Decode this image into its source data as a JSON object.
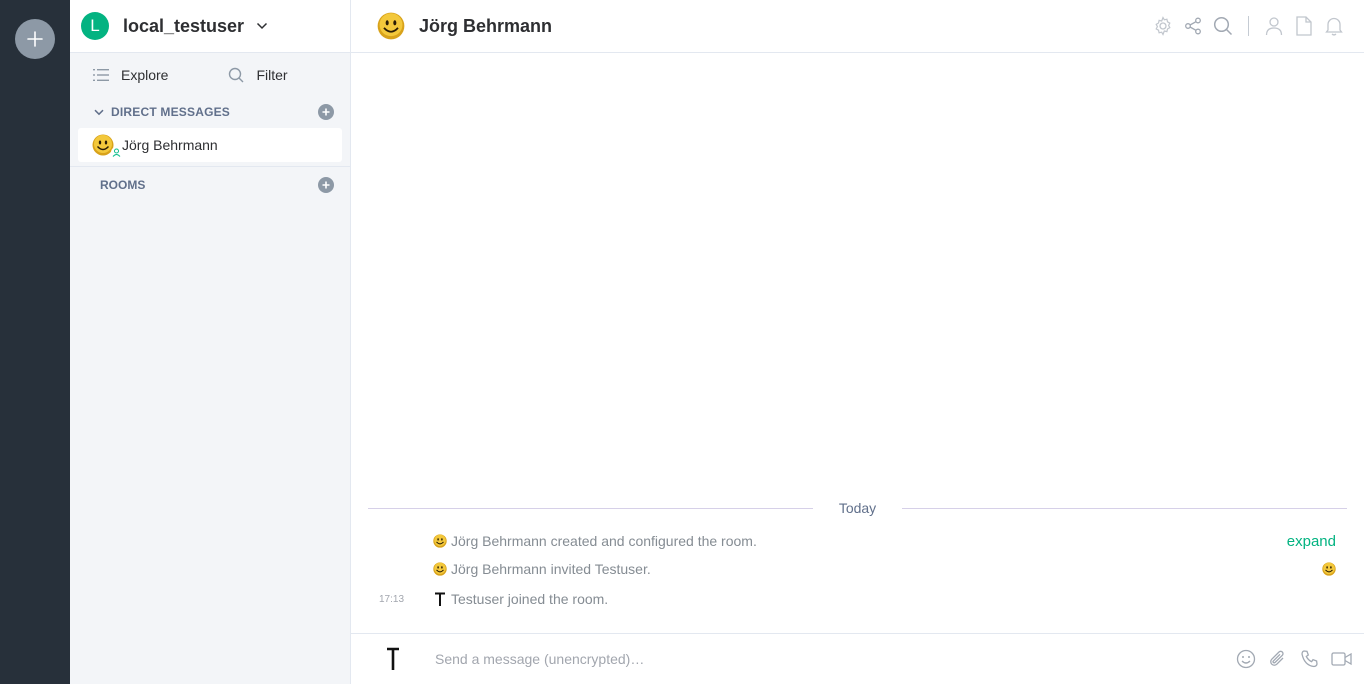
{
  "account": {
    "initial": "L",
    "name": "local_testuser"
  },
  "sidebar": {
    "explore_label": "Explore",
    "filter_label": "Filter",
    "direct_messages_title": "DIRECT MESSAGES",
    "dm_items": [
      {
        "name": "Jörg Behrmann"
      }
    ],
    "rooms_title": "ROOMS"
  },
  "room": {
    "name": "Jörg Behrmann"
  },
  "timeline": {
    "date_separator": "Today",
    "events": [
      {
        "text": "Jörg Behrmann created and configured the room.",
        "time": ""
      },
      {
        "text": "Jörg Behrmann invited Testuser.",
        "time": ""
      },
      {
        "text": "Testuser joined the room.",
        "time": "17:13"
      }
    ],
    "expand_label": "expand"
  },
  "composer": {
    "placeholder": "Send a message (unencrypted)…"
  },
  "colors": {
    "accent": "#03b381",
    "rail": "#27303a",
    "sidebar": "#f3f5f8"
  }
}
